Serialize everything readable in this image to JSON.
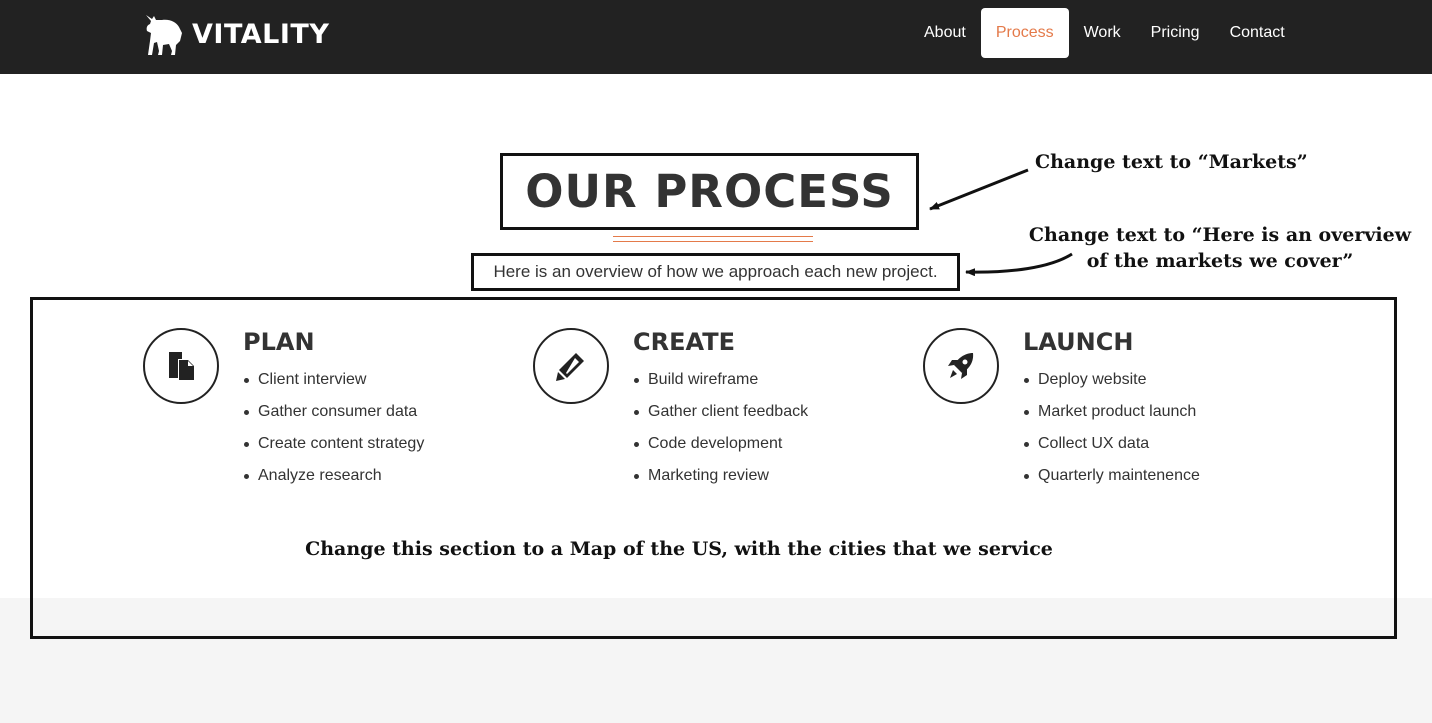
{
  "nav": {
    "brand": "VITALITY",
    "brand_icon": "bull-logo-icon",
    "links": [
      {
        "label": "About",
        "active": false
      },
      {
        "label": "Process",
        "active": true
      },
      {
        "label": "Work",
        "active": false
      },
      {
        "label": "Pricing",
        "active": false
      },
      {
        "label": "Contact",
        "active": false
      }
    ]
  },
  "colors": {
    "nav_bg": "#222222",
    "accent": "#e47a4a",
    "text": "#333333",
    "section_gray": "#f5f5f5"
  },
  "hero": {
    "title": "OUR PROCESS",
    "subtitle": "Here is an overview of how we approach each new project."
  },
  "columns": [
    {
      "icon": "document-icon",
      "title": "PLAN",
      "items": [
        "Client interview",
        "Gather consumer data",
        "Create content strategy",
        "Analyze research"
      ]
    },
    {
      "icon": "pencil-icon",
      "title": "CREATE",
      "items": [
        "Build wireframe",
        "Gather client feedback",
        "Code development",
        "Marketing review"
      ]
    },
    {
      "icon": "rocket-icon",
      "title": "LAUNCH",
      "items": [
        "Deploy website",
        "Market product launch",
        "Collect UX data",
        "Quarterly maintenence"
      ]
    }
  ],
  "annotations": {
    "title_note": "Change text to “Markets”",
    "subtitle_note": "Change text to “Here is an overview of the markets we cover”",
    "section_note": "Change this section to a Map of the US, with the cities that we service"
  }
}
